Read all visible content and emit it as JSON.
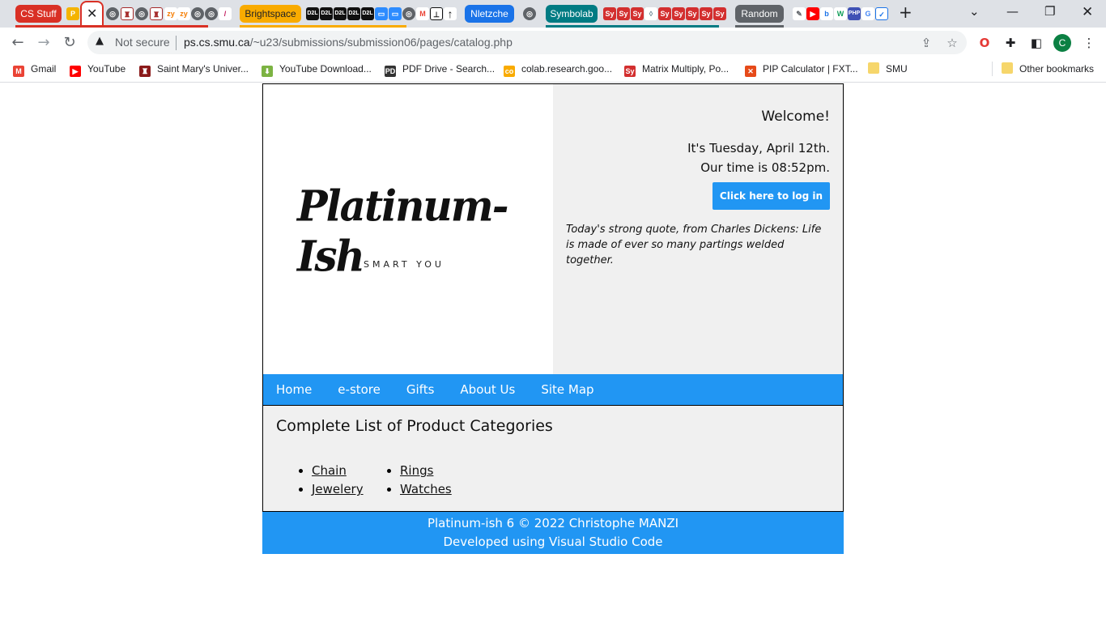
{
  "browser": {
    "tab_groups": [
      {
        "label": "CS Stuff",
        "color": "#d93025"
      },
      {
        "label": "Brightspace",
        "color": "#f9ab00"
      },
      {
        "label": "Nletzche",
        "color": "#1a73e8"
      },
      {
        "label": "Symbolab",
        "color": "#007b83"
      },
      {
        "label": "Random",
        "color": "#5f6368"
      }
    ],
    "address": {
      "security_label": "Not secure",
      "url_host": "ps.cs.smu.ca",
      "url_path": "/~u23/submissions/submission06/pages/catalog.php"
    },
    "profile_initial": "C",
    "bookmarks": [
      {
        "label": "Gmail",
        "icon": "gmail-icon",
        "color": "#ea4335",
        "glyph": "M"
      },
      {
        "label": "YouTube",
        "icon": "youtube-icon",
        "color": "#ff0000",
        "glyph": "▶"
      },
      {
        "label": "Saint Mary's Univer...",
        "icon": "smu-crest-icon",
        "color": "#8b1a1a",
        "glyph": "♜"
      },
      {
        "label": "YouTube Download...",
        "icon": "download-arrow-icon",
        "color": "#7cb342",
        "glyph": "⬇"
      },
      {
        "label": "PDF Drive - Search...",
        "icon": "pdf-drive-icon",
        "color": "#333333",
        "glyph": "PD"
      },
      {
        "label": "colab.research.goo...",
        "icon": "colab-icon",
        "color": "#f9ab00",
        "glyph": "co"
      },
      {
        "label": "Matrix Multiply, Po...",
        "icon": "symbolab-icon",
        "color": "#d32f2f",
        "glyph": "Sy"
      },
      {
        "label": "PIP Calculator | FXT...",
        "icon": "pip-calculator-icon",
        "color": "#e64a19",
        "glyph": "✕"
      },
      {
        "label": "SMU",
        "icon": "folder-icon",
        "color": "#f6d66b",
        "glyph": ""
      }
    ],
    "other_bookmarks": "Other bookmarks"
  },
  "site": {
    "logo_text": "Platinum-Ish",
    "logo_tagline": "SMART YOU",
    "welcome": "Welcome!",
    "date_line": "It's Tuesday, April 12th.",
    "time_line": "Our time is 08:52pm.",
    "login_label": "Click here to log in",
    "quote": "Today's strong quote, from Charles Dickens: Life is made of ever so many partings welded together.",
    "nav": [
      "Home",
      "e-store",
      "Gifts",
      "About Us",
      "Site Map"
    ],
    "content_title": "Complete List of Product Categories",
    "categories_col1": [
      "Chain",
      "Jewelery"
    ],
    "categories_col2": [
      "Rings",
      "Watches"
    ],
    "footer_line1": "Platinum-ish 6 © 2022 Christophe MANZI",
    "footer_line2": "Developed using Visual Studio Code"
  }
}
